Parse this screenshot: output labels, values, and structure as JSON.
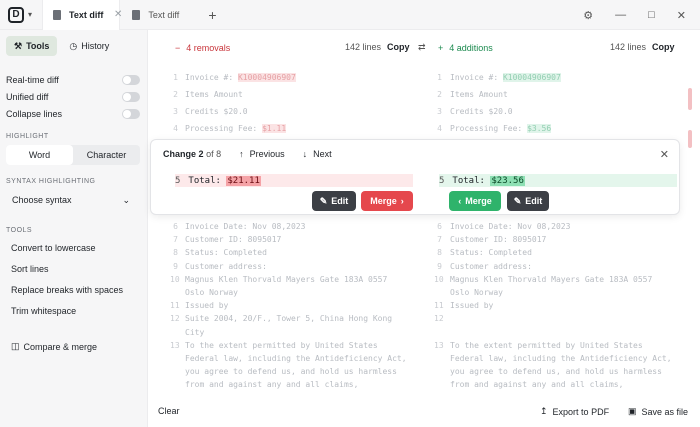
{
  "titlebar": {
    "logo": "D",
    "tabs": [
      {
        "label": "Text diff",
        "active": true
      },
      {
        "label": "Text diff",
        "active": false
      }
    ],
    "icons": [
      "gear-icon",
      "minimize-icon",
      "maximize-icon",
      "close-icon"
    ]
  },
  "sidebar": {
    "tools_label": "Tools",
    "history_label": "History",
    "options": [
      {
        "label": "Real-time diff",
        "on": false
      },
      {
        "label": "Unified diff",
        "on": false
      },
      {
        "label": "Collapse lines",
        "on": false
      }
    ],
    "highlight_heading": "HIGHLIGHT",
    "highlight_options": [
      "Word",
      "Character"
    ],
    "syntax_heading": "SYNTAX HIGHLIGHTING",
    "syntax_select": "Choose syntax",
    "tools_heading": "TOOLS",
    "tools": [
      "Convert to lowercase",
      "Sort lines",
      "Replace breaks with spaces",
      "Trim whitespace"
    ],
    "compare_merge": "Compare & merge"
  },
  "left_pane": {
    "count_label": "4 removals",
    "lines_label": "142 lines",
    "copy_label": "Copy",
    "top_lines": [
      {
        "n": "1",
        "text": "Invoice #: ",
        "hl": "K10004906907"
      },
      {
        "n": "2",
        "text": "Items Amount",
        "hl": ""
      },
      {
        "n": "3",
        "text": "Credits $20.0",
        "hl": ""
      },
      {
        "n": "4",
        "text": "Processing Fee: ",
        "hl": "$1.11"
      }
    ],
    "bottom_lines": [
      {
        "n": "6",
        "text": "Invoice Date: Nov 08,2023"
      },
      {
        "n": "7",
        "text": "Customer ID: 8095017"
      },
      {
        "n": "8",
        "text": "Status: Completed"
      },
      {
        "n": "9",
        "text": "Customer address:"
      },
      {
        "n": "10",
        "text": "Magnus Klen Thorvald Mayers Gate 183A 0557"
      },
      {
        "n": "",
        "text": "Oslo Norway"
      },
      {
        "n": "11",
        "text": "Issued by"
      },
      {
        "n": "12",
        "text": "Suite 2004, 20/F., Tower 5, China Hong Kong"
      },
      {
        "n": "",
        "text": "City"
      },
      {
        "n": "13",
        "text": "To the extent permitted by United States"
      },
      {
        "n": "",
        "text": "Federal law, including the Antideficiency Act,"
      },
      {
        "n": "",
        "text": "you agree to defend us, and hold us harmless"
      },
      {
        "n": "",
        "text": "from and against any and all claims,"
      }
    ]
  },
  "right_pane": {
    "count_label": "4 additions",
    "lines_label": "142 lines",
    "copy_label": "Copy",
    "top_lines": [
      {
        "n": "1",
        "text": "Invoice #: ",
        "hl": "K10004906907"
      },
      {
        "n": "2",
        "text": "Items Amount",
        "hl": ""
      },
      {
        "n": "3",
        "text": "Credits $20.0",
        "hl": ""
      },
      {
        "n": "4",
        "text": "Processing Fee: ",
        "hl": "$3.56"
      }
    ],
    "bottom_lines": [
      {
        "n": "6",
        "text": "Invoice Date: Nov 08,2023"
      },
      {
        "n": "7",
        "text": "Customer ID: 8095017"
      },
      {
        "n": "8",
        "text": "Status: Completed"
      },
      {
        "n": "9",
        "text": "Customer address:"
      },
      {
        "n": "10",
        "text": "Magnus Klen Thorvald Mayers Gate 183A 0557"
      },
      {
        "n": "",
        "text": "Oslo Norway"
      },
      {
        "n": "11",
        "text": "Issued by"
      },
      {
        "n": "12",
        "text": ""
      },
      {
        "n": "",
        "text": ""
      },
      {
        "n": "13",
        "text": "To the extent permitted by United States"
      },
      {
        "n": "",
        "text": "Federal law, including the Antideficiency Act,"
      },
      {
        "n": "",
        "text": "you agree to defend us, and hold us harmless"
      },
      {
        "n": "",
        "text": "from and against any and all claims,"
      }
    ]
  },
  "popup": {
    "change_prefix": "Change",
    "change_index": "2",
    "change_of": "of 8",
    "previous_label": "Previous",
    "next_label": "Next",
    "left_line_num": "5",
    "left_text": "Total: ",
    "left_value": "$21.11",
    "right_line_num": "5",
    "right_text": "Total: ",
    "right_value": "$23.56",
    "edit_label": "Edit",
    "merge_label": "Merge"
  },
  "footer": {
    "clear_label": "Clear",
    "export_label": "Export to PDF",
    "save_label": "Save as file"
  },
  "colors": {
    "removal": "#e5484d",
    "addition": "#2fb36b"
  }
}
